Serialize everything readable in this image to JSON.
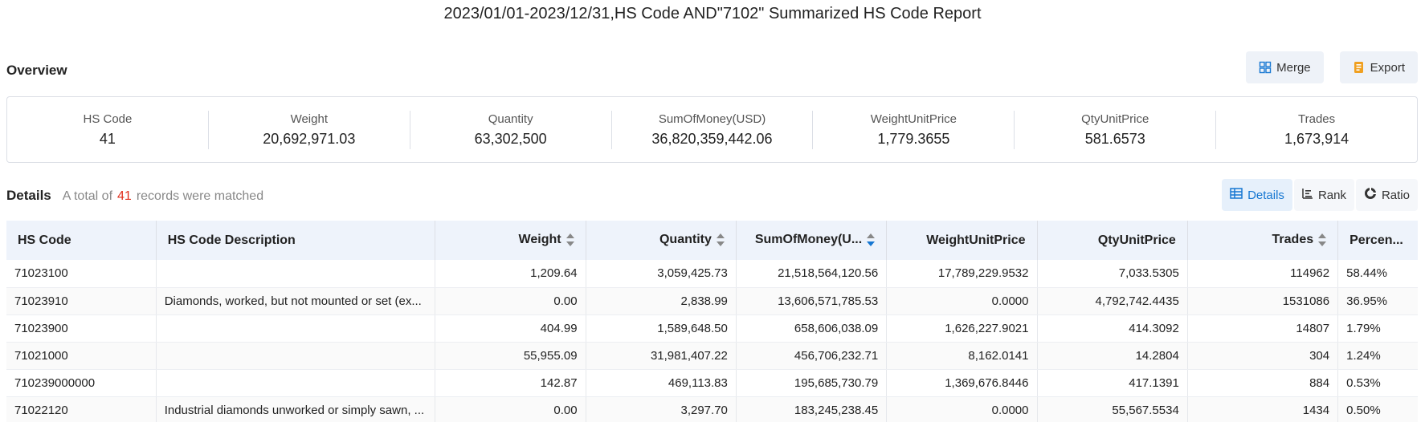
{
  "report_title": "2023/01/01-2023/12/31,HS Code AND\"7102\" Summarized HS Code Report",
  "overview": {
    "title": "Overview",
    "merge_label": "Merge",
    "export_label": "Export",
    "summary": [
      {
        "label": "HS Code",
        "value": "41"
      },
      {
        "label": "Weight",
        "value": "20,692,971.03"
      },
      {
        "label": "Quantity",
        "value": "63,302,500"
      },
      {
        "label": "SumOfMoney(USD)",
        "value": "36,820,359,442.06"
      },
      {
        "label": "WeightUnitPrice",
        "value": "1,779.3655"
      },
      {
        "label": "QtyUnitPrice",
        "value": "581.6573"
      },
      {
        "label": "Trades",
        "value": "1,673,914"
      }
    ]
  },
  "details": {
    "title": "Details",
    "note_prefix": "A total of",
    "count": "41",
    "note_suffix": "records were matched",
    "tabs": [
      "Details",
      "Rank",
      "Ratio"
    ],
    "active_tab": "Details"
  },
  "table": {
    "columns": [
      "HS Code",
      "HS Code Description",
      "Weight",
      "Quantity",
      "SumOfMoney(U...",
      "WeightUnitPrice",
      "QtyUnitPrice",
      "Trades",
      "Percen..."
    ],
    "rows": [
      [
        "71023100",
        "",
        "1,209.64",
        "3,059,425.73",
        "21,518,564,120.56",
        "17,789,229.9532",
        "7,033.5305",
        "114962",
        "58.44%"
      ],
      [
        "71023910",
        "Diamonds, worked, but not mounted or set (ex...",
        "0.00",
        "2,838.99",
        "13,606,571,785.53",
        "0.0000",
        "4,792,742.4435",
        "1531086",
        "36.95%"
      ],
      [
        "71023900",
        "",
        "404.99",
        "1,589,648.50",
        "658,606,038.09",
        "1,626,227.9021",
        "414.3092",
        "14807",
        "1.79%"
      ],
      [
        "71021000",
        "",
        "55,955.09",
        "31,981,407.22",
        "456,706,232.71",
        "8,162.0141",
        "14.2804",
        "304",
        "1.24%"
      ],
      [
        "710239000000",
        "",
        "142.87",
        "469,113.83",
        "195,685,730.79",
        "1,369,676.8446",
        "417.1391",
        "884",
        "0.53%"
      ],
      [
        "71022120",
        "Industrial diamonds unworked or simply sawn, ...",
        "0.00",
        "3,297.70",
        "183,245,238.45",
        "0.0000",
        "55,567.5534",
        "1434",
        "0.50%"
      ]
    ]
  },
  "colors": {
    "accent": "#1677d2",
    "count_red": "#e0301e",
    "export_icon": "#f0a020"
  }
}
